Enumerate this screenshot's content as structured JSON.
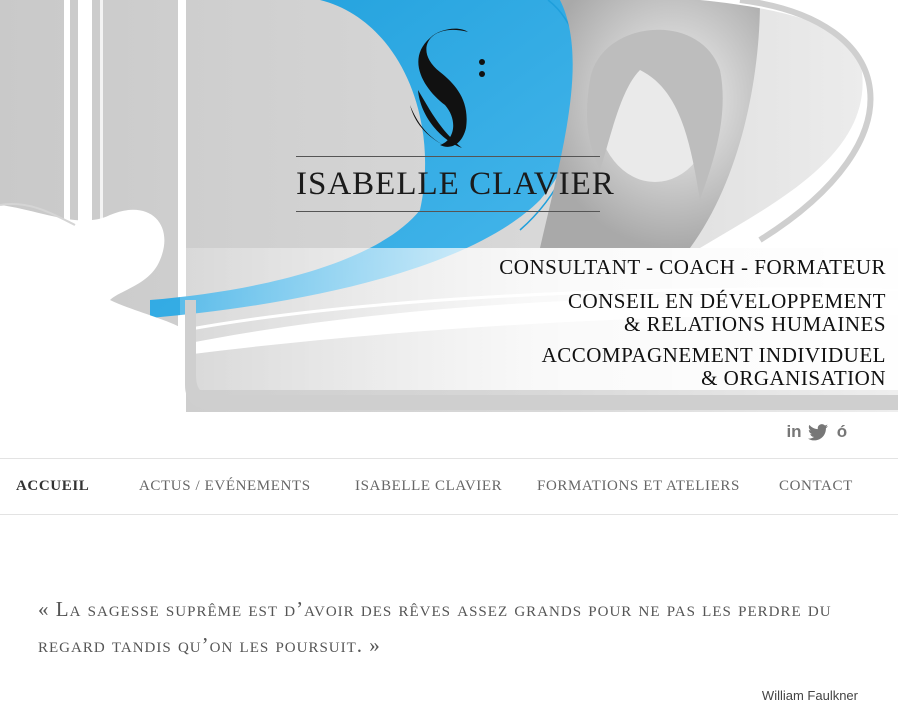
{
  "header": {
    "name": "ISABELLE CLAVIER",
    "taglines": [
      "CONSULTANT - COACH - FORMATEUR",
      "CONSEIL EN DÉVELOPPEMENT",
      "& RELATIONS HUMAINES",
      "ACCOMPAGNEMENT INDIVIDUEL",
      "& ORGANISATION"
    ],
    "accent_color": "#2aaae2"
  },
  "social": {
    "linkedin": "in",
    "twitter": "❖",
    "viadeo": "ó"
  },
  "nav": {
    "items": [
      {
        "label": "ACCUEIL"
      },
      {
        "label": "ACTUS / EVÉNEMENTS"
      },
      {
        "label": "ISABELLE CLAVIER"
      },
      {
        "label": "FORMATIONS ET ATELIERS"
      },
      {
        "label": "CONTACT"
      }
    ]
  },
  "quote": {
    "text": "« La sagesse suprême est d’avoir des rêves assez grands pour ne pas les perdre du regard tandis qu’on les poursuit.  »",
    "author": "William Faulkner"
  }
}
